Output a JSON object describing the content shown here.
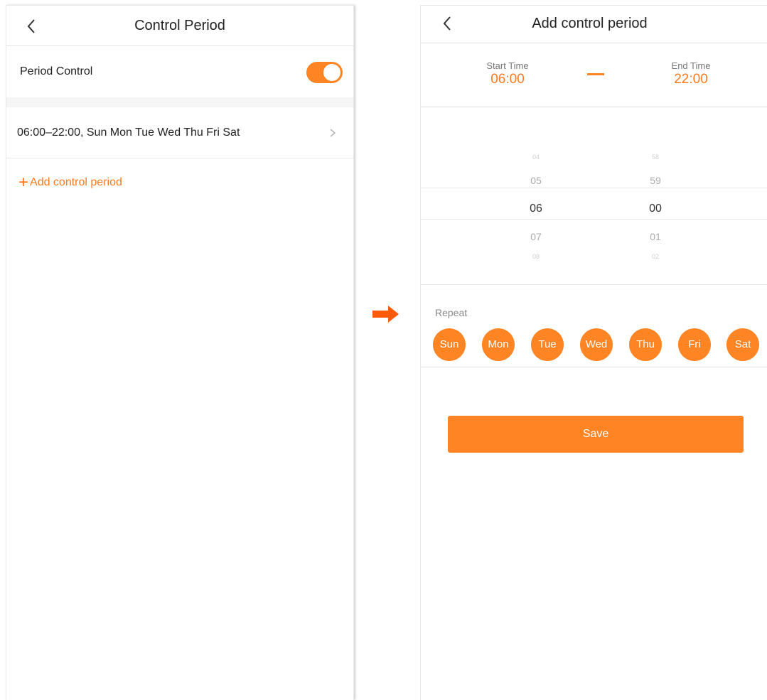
{
  "left_screen": {
    "title": "Control Period",
    "period_control_label": "Period Control",
    "period_control_enabled": true,
    "period_entry": "06:00–22:00, Sun Mon Tue Wed Thu Fri Sat",
    "add_link_plus": "+",
    "add_link_label": "Add control period"
  },
  "right_screen": {
    "title": "Add control period",
    "start_caption": "Start Time",
    "start_value": "06:00",
    "end_caption": "End Time",
    "end_value": "22:00",
    "hours": [
      "04",
      "05",
      "06",
      "07",
      "08"
    ],
    "minutes": [
      "58",
      "59",
      "00",
      "01",
      "02"
    ],
    "repeat_label": "Repeat",
    "days": [
      "Sun",
      "Mon",
      "Tue",
      "Wed",
      "Thu",
      "Fri",
      "Sat"
    ],
    "save_label": "Save"
  },
  "colors": {
    "accent": "#ff8424",
    "accent_text": "#ff7a1f",
    "arrow": "#ff5a0a"
  }
}
